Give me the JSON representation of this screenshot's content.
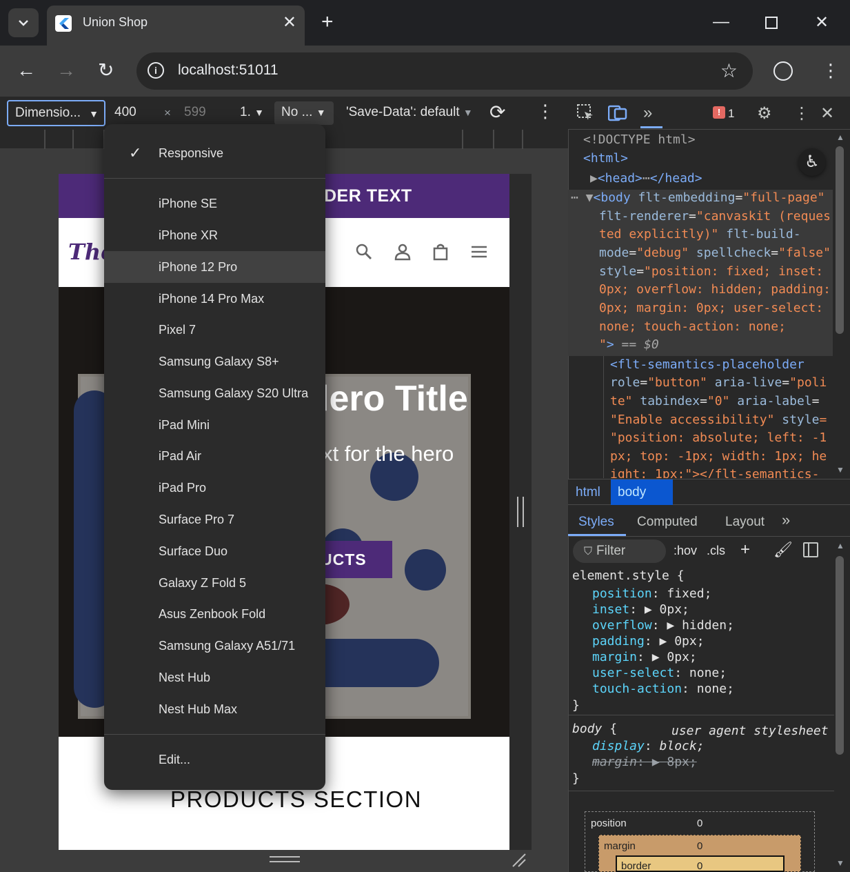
{
  "browser": {
    "tab_title": "Union Shop",
    "url": "localhost:51011"
  },
  "device_toolbar": {
    "dimensions": "Dimensio...",
    "width": "400",
    "times": "×",
    "height": "599",
    "zoom": "1.",
    "throttle": "No ...",
    "save_data": "'Save-Data': default"
  },
  "site": {
    "banner_text": "DER TEXT",
    "logo": "The",
    "hero_title": "Hero Title",
    "hero_title_visible": "lero Title",
    "hero_subtitle": "xt for the hero",
    "hero_button": "UCTS",
    "products_title": "PRODUCTS SECTION"
  },
  "device_menu": {
    "selected": "Responsive",
    "items": [
      "iPhone SE",
      "iPhone XR",
      "iPhone 12 Pro",
      "iPhone 14 Pro Max",
      "Pixel 7",
      "Samsung Galaxy S8+",
      "Samsung Galaxy S20 Ultra",
      "iPad Mini",
      "iPad Air",
      "iPad Pro",
      "Surface Pro 7",
      "Surface Duo",
      "Galaxy Z Fold 5",
      "Asus Zenbook Fold",
      "Samsung Galaxy A51/71",
      "Nest Hub",
      "Nest Hub Max"
    ],
    "highlighted": "iPhone 12 Pro",
    "edit": "Edit..."
  },
  "devtools": {
    "issues_count": "1",
    "breadcrumbs": [
      "html",
      "body"
    ],
    "tabs": [
      "Styles",
      "Computed",
      "Layout"
    ],
    "filter_placeholder": "Filter",
    "hov": ":hov",
    "cls": ".cls",
    "user_agent_label": "user agent stylesheet",
    "box_model": {
      "position": "position",
      "position_val": "0",
      "margin": "margin",
      "margin_val": "0",
      "border": "border",
      "border_val": "0"
    }
  },
  "colors": {
    "brand_purple": "#4d2a78",
    "devtools_blue": "#7cacf8",
    "selected_crumb": "#0b57d0"
  }
}
